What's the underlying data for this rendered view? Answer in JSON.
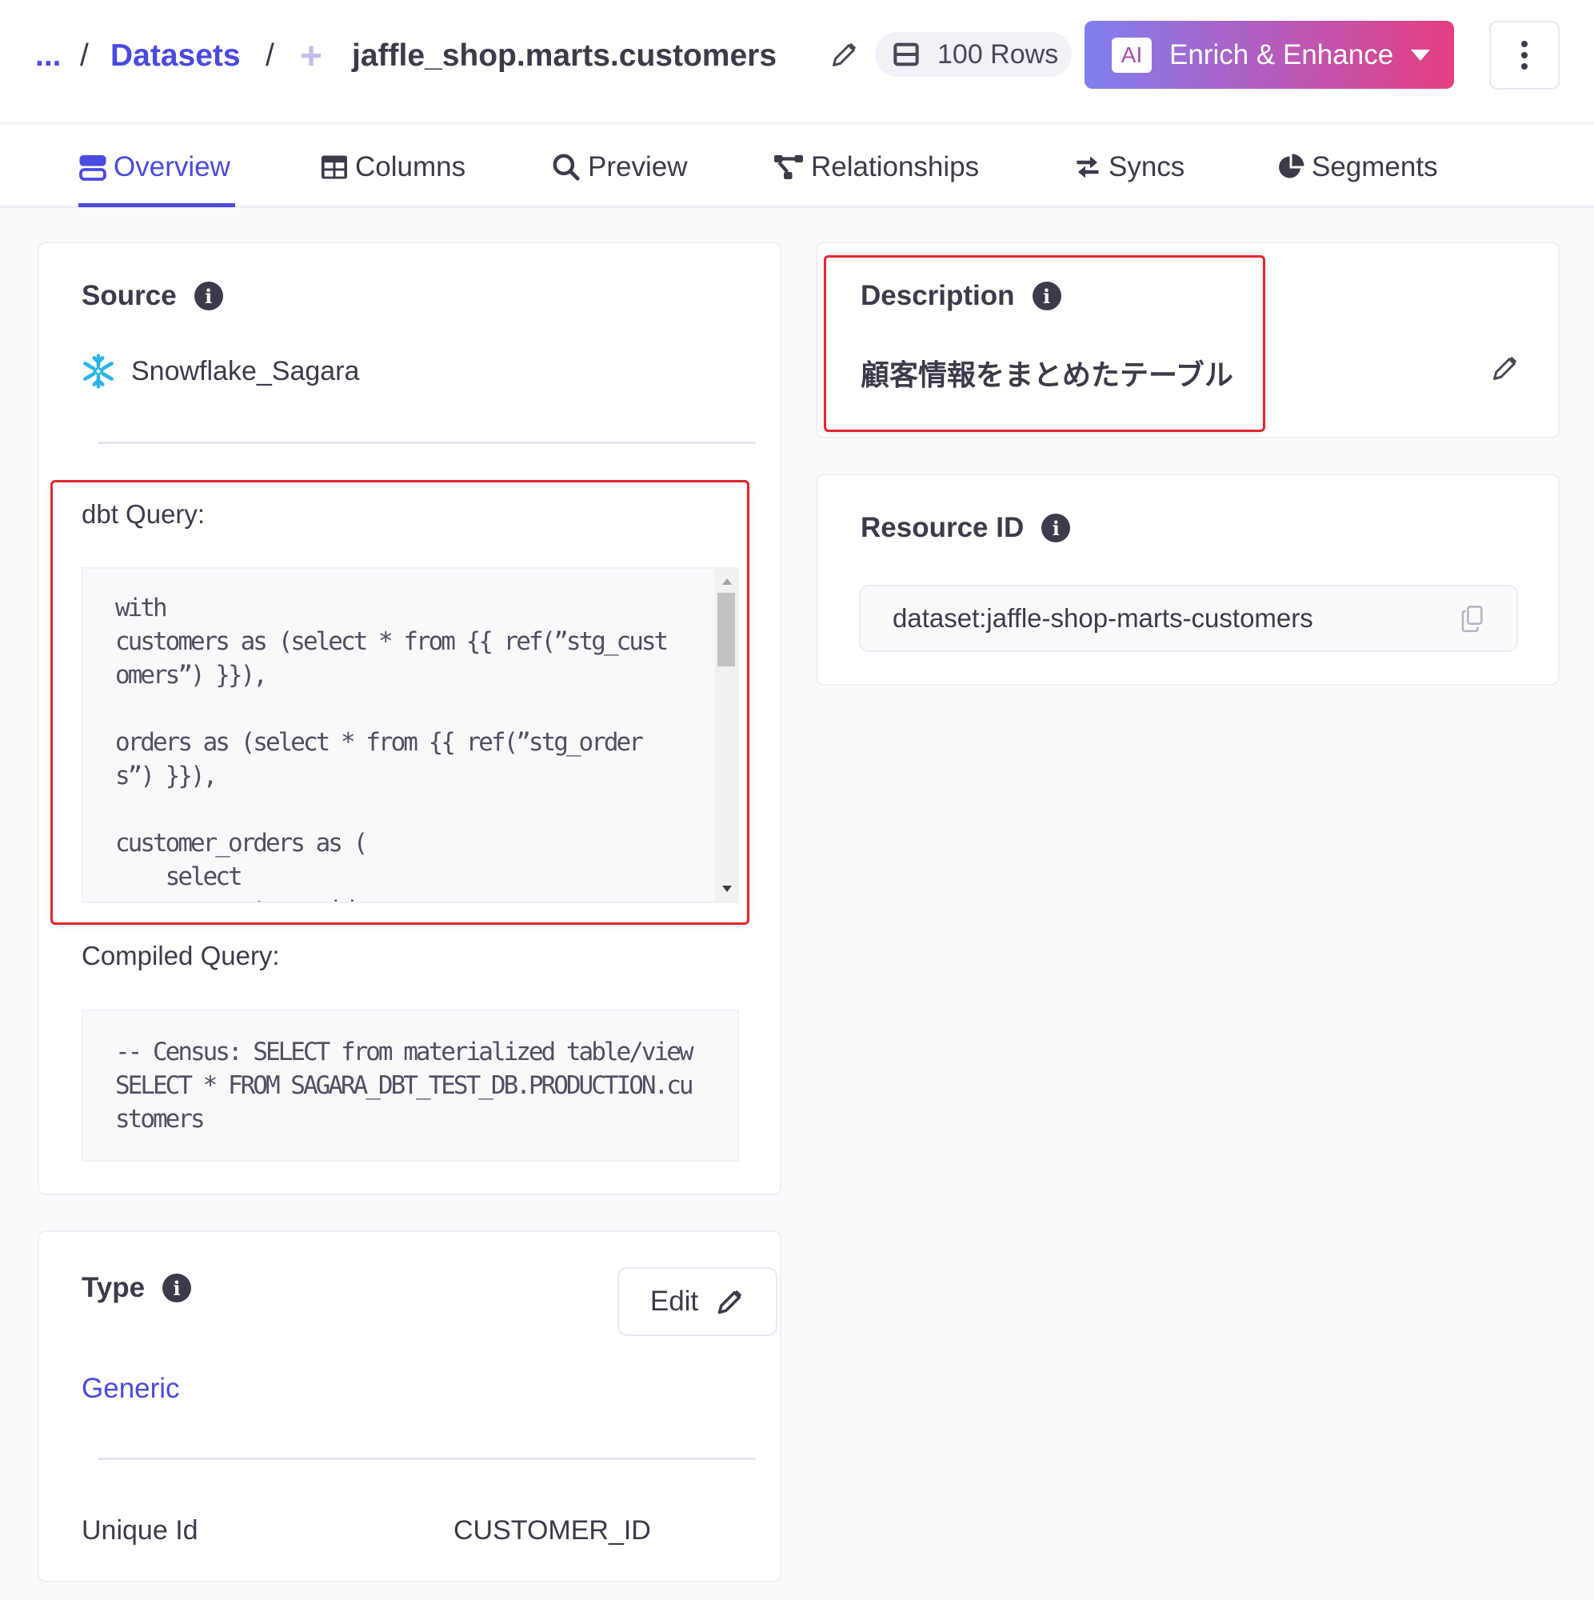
{
  "header": {
    "breadcrumb": {
      "ellipsis": "...",
      "separator": "/",
      "datasets": "Datasets",
      "title": "jaffle_shop.marts.customers"
    },
    "rows_badge": "100 Rows",
    "enrich_button": {
      "badge": "AI",
      "label": "Enrich & Enhance"
    }
  },
  "tabs": [
    {
      "label": "Overview",
      "icon": "overview-icon",
      "active": true
    },
    {
      "label": "Columns",
      "icon": "table-icon",
      "active": false
    },
    {
      "label": "Preview",
      "icon": "search-icon",
      "active": false
    },
    {
      "label": "Relationships",
      "icon": "relationships-icon",
      "active": false
    },
    {
      "label": "Syncs",
      "icon": "sync-arrows-icon",
      "active": false
    },
    {
      "label": "Segments",
      "icon": "pie-chart-icon",
      "active": false
    }
  ],
  "source_card": {
    "title": "Source",
    "source_name": "Snowflake_Sagara",
    "dbt_query_label": "dbt Query:",
    "dbt_query": "with\ncustomers as (select * from {{ ref(”stg_cust\nomers”) }}),\n\norders as (select * from {{ ref(”stg_order\ns”) }}),\n\ncustomer_orders as (\n    select\n        customer_id,",
    "compiled_query_label": "Compiled Query:",
    "compiled_query": "-- Census: SELECT from materialized table/view\nSELECT * FROM SAGARA_DBT_TEST_DB.PRODUCTION.cu\nstomers"
  },
  "type_card": {
    "title": "Type",
    "edit_label": "Edit",
    "type_value": "Generic",
    "unique_id_label": "Unique Id",
    "unique_id_value": "CUSTOMER_ID"
  },
  "description_card": {
    "title": "Description",
    "text": "顧客情報をまとめたテーブル"
  },
  "resource_card": {
    "title": "Resource ID",
    "value": "dataset:jaffle-shop-marts-customers"
  },
  "colors": {
    "accent": "#4a4ae0",
    "highlight_border": "#e5262d",
    "gradient_start": "#7f7ff0",
    "gradient_end": "#e53e80"
  }
}
